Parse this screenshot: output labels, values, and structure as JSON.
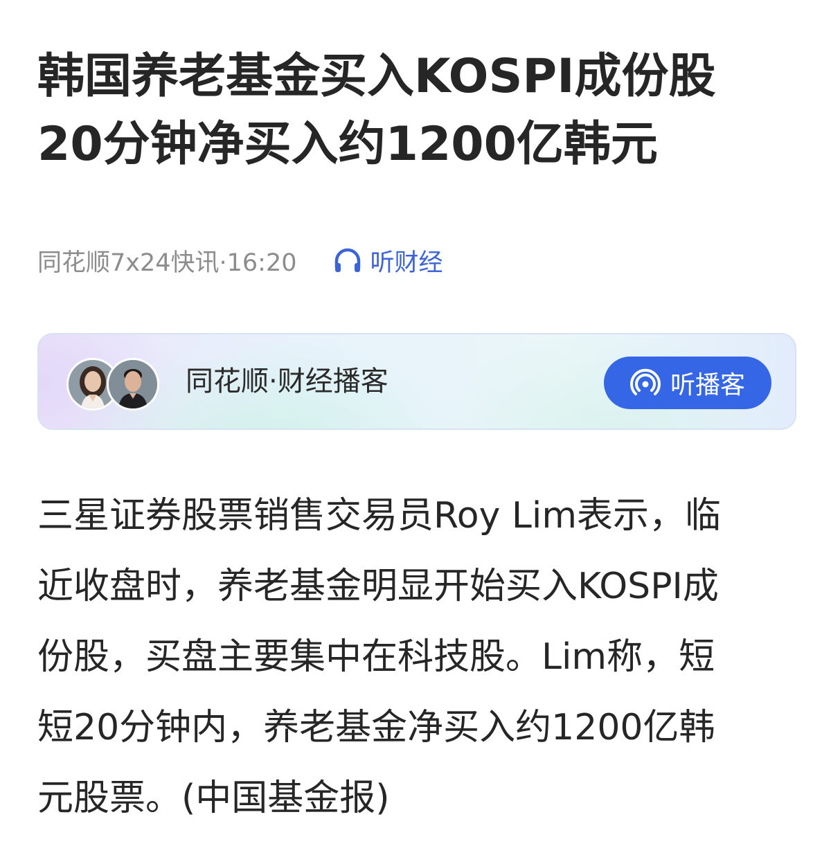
{
  "article": {
    "headline_lines": [
      "韩国养老基金买入KOSPI成份股",
      "20分钟净买入约1200亿韩元"
    ],
    "source": "同花顺7x24快讯·16:20",
    "listen": {
      "icon": "headphones-icon",
      "label": "听财经"
    },
    "body_lines": [
      "三星证券股票销售交易员Roy Lim表示，临",
      "近收盘时，养老基金明显开始买入KOSPI成",
      "份股，买盘主要集中在科技股。Lim称，短",
      "短20分钟内，养老基金净买入约1200亿韩",
      "元股票。(中国基金报)"
    ]
  },
  "podcast_card": {
    "title": "同花顺·财经播客",
    "button_label": "听播客",
    "button_icon": "broadcast-icon",
    "avatars": [
      "host-avatar-female",
      "host-avatar-male"
    ]
  },
  "colors": {
    "headline": "#262626",
    "meta": "#8c8c8c",
    "link": "#3d63d8",
    "button": "#3566e6"
  }
}
